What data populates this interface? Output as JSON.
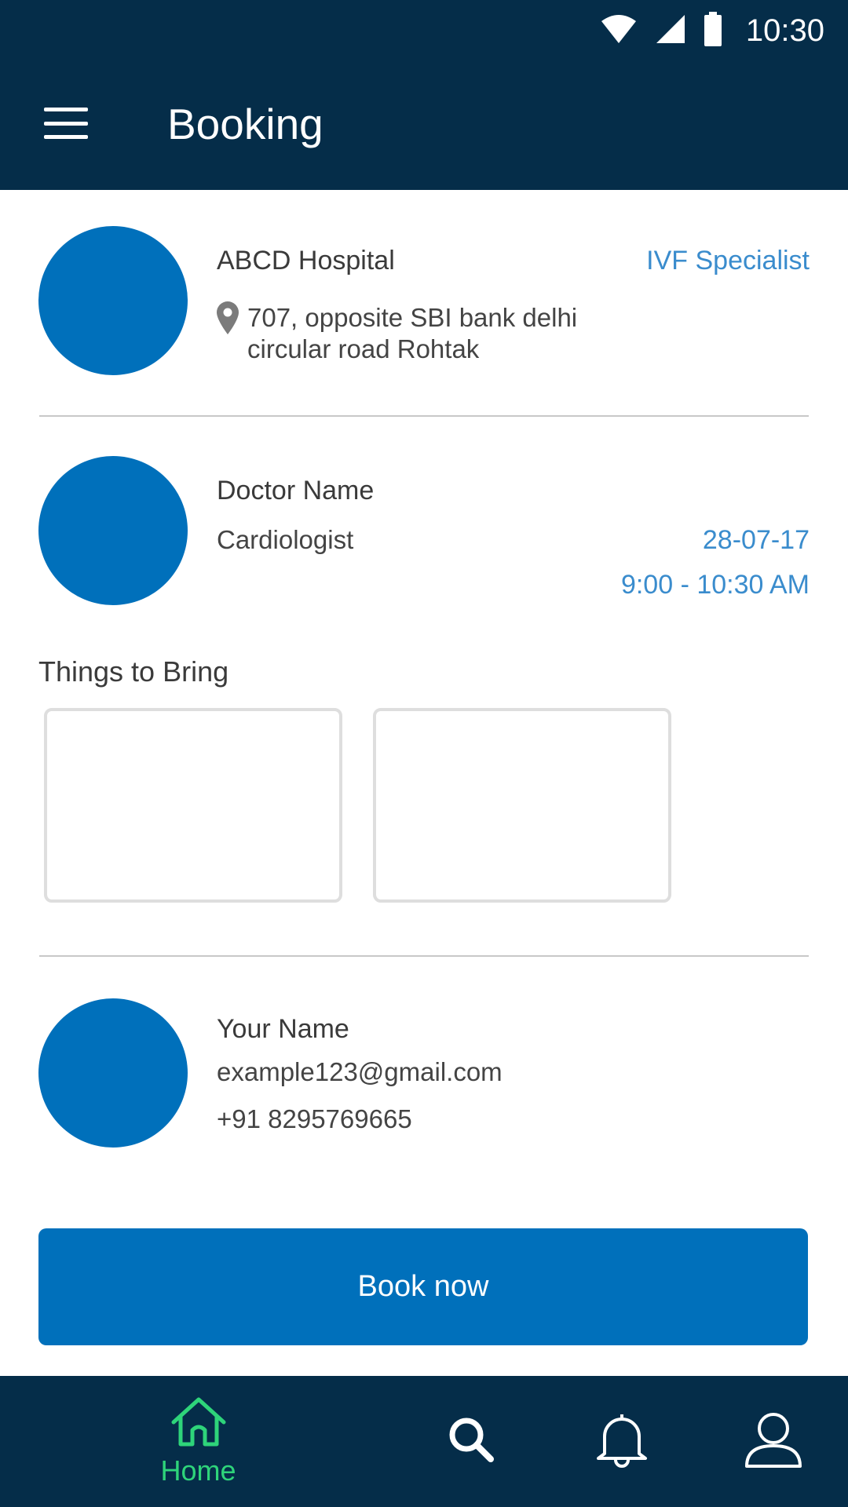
{
  "status_bar": {
    "time": "10:30",
    "icons": [
      "wifi-icon",
      "signal-icon",
      "battery-icon"
    ]
  },
  "app_bar": {
    "title": "Booking",
    "menu_icon": "hamburger-menu-icon"
  },
  "hospital": {
    "name": "ABCD Hospital",
    "specialty": "IVF Specialist",
    "address_line1": "707, opposite SBI bank delhi",
    "address_line2": "circular road Rohtak"
  },
  "doctor": {
    "name": "Doctor Name",
    "specialty": "Cardiologist",
    "date": "28-07-17",
    "time": "9:00 - 10:30 AM"
  },
  "things_to_bring": {
    "heading": "Things to Bring"
  },
  "user": {
    "name": "Your Name",
    "email": "example123@gmail.com",
    "phone": "+91 8295769665"
  },
  "book_button": {
    "label": "Book now"
  },
  "bottom_nav": {
    "home_label": "Home",
    "items": [
      "home-icon",
      "search-icon",
      "bell-icon",
      "profile-icon"
    ]
  },
  "colors": {
    "app_bar": "#052d49",
    "accent_blue": "#0070bb",
    "link_blue": "#3a8ccd",
    "nav_active": "#2ed47a"
  }
}
